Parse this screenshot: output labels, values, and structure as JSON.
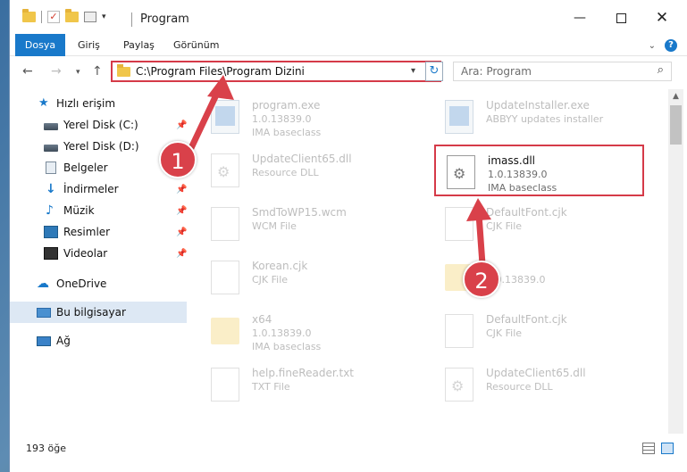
{
  "window": {
    "title": "Program",
    "controls": {
      "minimize": "—",
      "maximize": "",
      "close": "✕"
    }
  },
  "ribbon": {
    "tabs": [
      "Dosya",
      "Giriş",
      "Paylaş",
      "Görünüm"
    ],
    "help": "?"
  },
  "nav": {
    "back": "←",
    "forward": "→",
    "recent": "▾",
    "up": "↑",
    "address": "C:\\Program Files\\Program Dizini",
    "address_dropdown": "▾",
    "refresh": "↻",
    "search_placeholder": "Ara: Program",
    "search_icon": "⌕"
  },
  "sidebar": {
    "items": [
      {
        "label": "Hızlı erişim",
        "icon": "star-icon",
        "pinned": false
      },
      {
        "label": "Yerel Disk (C:)",
        "icon": "drive-icon",
        "pinned": true
      },
      {
        "label": "Yerel Disk (D:)",
        "icon": "drive-icon",
        "pinned": false
      },
      {
        "label": "Belgeler",
        "icon": "documents-icon",
        "pinned": true
      },
      {
        "label": "İndirmeler",
        "icon": "download-icon",
        "pinned": true
      },
      {
        "label": "Müzik",
        "icon": "music-icon",
        "pinned": true
      },
      {
        "label": "Resimler",
        "icon": "pictures-icon",
        "pinned": true
      },
      {
        "label": "Videolar",
        "icon": "videos-icon",
        "pinned": true
      },
      {
        "label": "OneDrive",
        "icon": "cloud-icon",
        "pinned": false
      },
      {
        "label": "Bu bilgisayar",
        "icon": "computer-icon",
        "pinned": false,
        "active": true
      },
      {
        "label": "Ağ",
        "icon": "network-icon",
        "pinned": false
      }
    ],
    "pin_glyph": "📌"
  },
  "files": [
    {
      "name": "program.exe",
      "line1": "1.0.13839.0",
      "line2": "IMA baseclass",
      "type": "exe",
      "faded": true
    },
    {
      "name": "UpdateInstaller.exe",
      "line1": "ABBYY updates installer",
      "line2": "",
      "type": "exe",
      "faded": true
    },
    {
      "name": "UpdateClient65.dll",
      "line1": "Resource DLL",
      "line2": "",
      "type": "dll",
      "faded": true
    },
    {
      "name": "imass.dll",
      "line1": "1.0.13839.0",
      "line2": "IMA baseclass",
      "type": "dll",
      "faded": false,
      "highlighted": true
    },
    {
      "name": "SmdToWP15.wcm",
      "line1": "WCM File",
      "line2": "",
      "type": "page",
      "faded": true
    },
    {
      "name": "DefaultFont.cjk",
      "line1": "CJK File",
      "line2": "",
      "type": "page",
      "faded": true
    },
    {
      "name": "Korean.cjk",
      "line1": "CJK File",
      "line2": "",
      "type": "page",
      "faded": true
    },
    {
      "name": "",
      "line1": "1.0.13839.0",
      "line2": "",
      "type": "folder",
      "faded": true
    },
    {
      "name": "x64",
      "line1": "1.0.13839.0",
      "line2": "IMA baseclass",
      "type": "folder",
      "faded": true
    },
    {
      "name": "DefaultFont.cjk",
      "line1": "CJK File",
      "line2": "",
      "type": "page",
      "faded": true
    },
    {
      "name": "help.fineReader.txt",
      "line1": "TXT File",
      "line2": "",
      "type": "page",
      "faded": true
    },
    {
      "name": "UpdateClient65.dll",
      "line1": "Resource DLL",
      "line2": "",
      "type": "dll",
      "faded": true
    }
  ],
  "status": {
    "count": "193 öğe"
  },
  "annotations": {
    "marker1": "1",
    "marker2": "2",
    "color": "#d9414a"
  }
}
